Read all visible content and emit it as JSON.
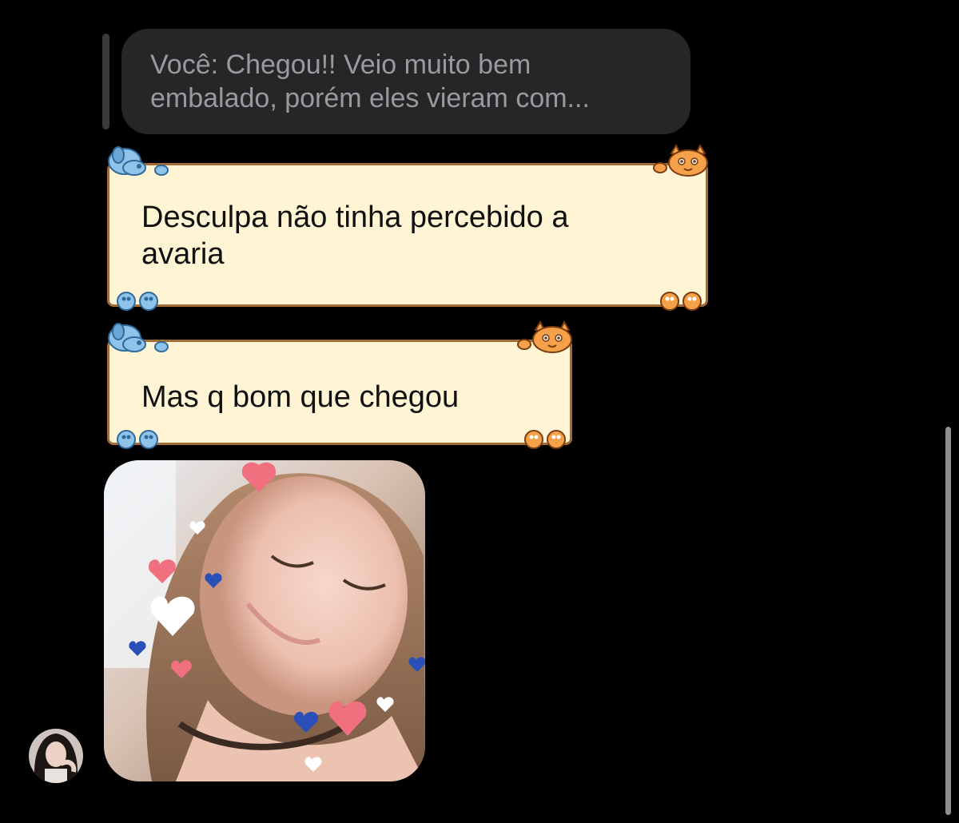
{
  "reply_preview": {
    "line1": "Você: Chegou!! Veio muito bem",
    "line2": "embalado, porém eles vieram com..."
  },
  "messages": [
    {
      "line1": "Desculpa não tinha percebido a",
      "line2": "avaria"
    },
    {
      "line1": "Mas q bom que chegou"
    }
  ],
  "photo": {
    "icon": "heart-filter-selfie"
  },
  "theme": {
    "bubble_fill": "#fff4d4",
    "bubble_border": "#a26c38",
    "dog_color": "#8fc3ea",
    "cat_color": "#f5a14a",
    "reply_fill": "#262628",
    "reply_text": "#9a9a9e",
    "background": "#000000"
  }
}
